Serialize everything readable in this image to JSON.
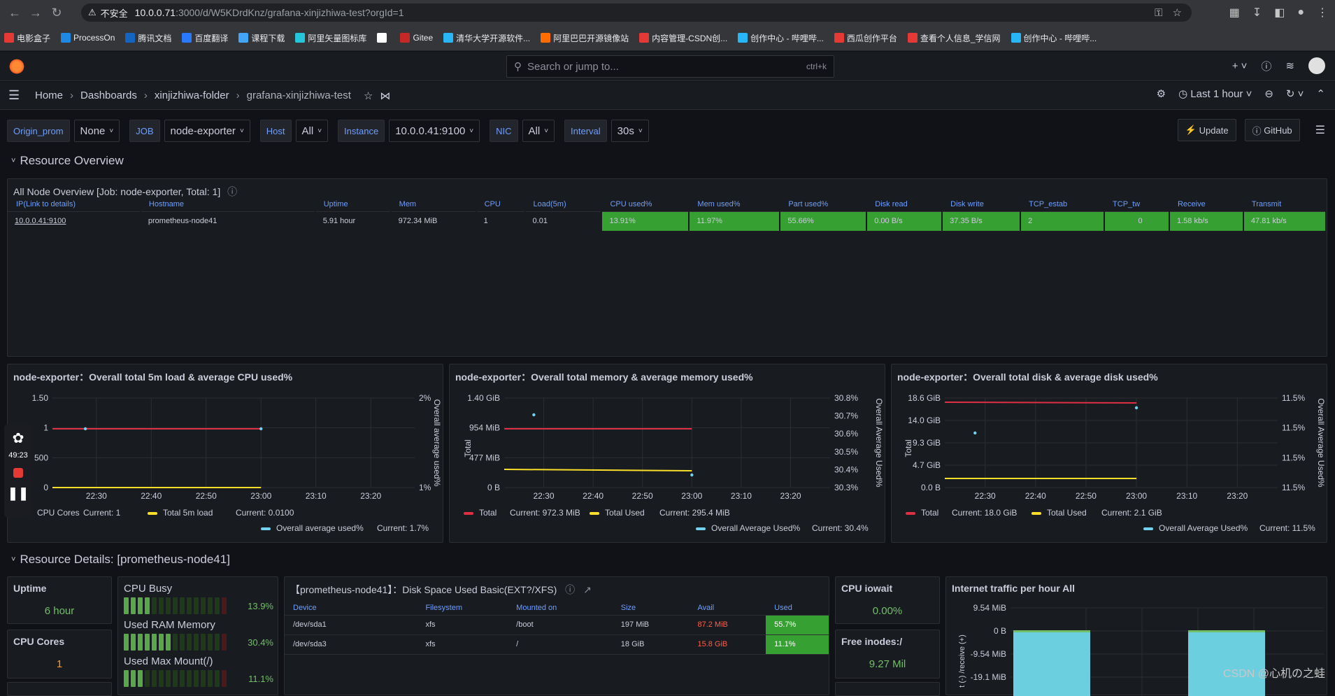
{
  "browser": {
    "security_warning": "不安全",
    "url_host": "10.0.0.71",
    "url_path": ":3000/d/W5KDrdKnz/grafana-xinjizhiwa-test?orgId=1",
    "bookmarks": [
      {
        "label": "电影盒子",
        "color": "#e53935"
      },
      {
        "label": "ProcessOn",
        "color": "#1e88e5"
      },
      {
        "label": "腾讯文档",
        "color": "#1565c0"
      },
      {
        "label": "百度翻译",
        "color": "#2979ff"
      },
      {
        "label": "课程下载",
        "color": "#42a5f5"
      },
      {
        "label": "阿里矢量图标库",
        "color": "#26c6da"
      },
      {
        "label": "",
        "color": "#ffffff"
      },
      {
        "label": "Gitee",
        "color": "#c62828"
      },
      {
        "label": "清华大学开源软件...",
        "color": "#29b6f6"
      },
      {
        "label": "阿里巴巴开源镜像站",
        "color": "#ff6d00"
      },
      {
        "label": "内容管理-CSDN创...",
        "color": "#e53935"
      },
      {
        "label": "创作中心 - 哔哩哔...",
        "color": "#29b6f6"
      },
      {
        "label": "西瓜创作平台",
        "color": "#e53935"
      },
      {
        "label": "查看个人信息_学信网",
        "color": "#e53935"
      },
      {
        "label": "创作中心 - 哔哩哔...",
        "color": "#29b6f6"
      }
    ]
  },
  "grafana": {
    "search_placeholder": "Search or jump to...",
    "search_shortcut": "ctrl+k",
    "breadcrumbs": [
      "Home",
      "Dashboards",
      "xinjizhiwa-folder",
      "grafana-xinjizhiwa-test"
    ],
    "time_range": "Last 1 hour",
    "variables": [
      {
        "label": "Origin_prom",
        "value": "None"
      },
      {
        "label": "JOB",
        "value": "node-exporter"
      },
      {
        "label": "Host",
        "value": "All"
      },
      {
        "label": "Instance",
        "value": "10.0.0.41:9100"
      },
      {
        "label": "NIC",
        "value": "All"
      },
      {
        "label": "Interval",
        "value": "30s"
      }
    ],
    "update_label": "Update",
    "github_label": "GitHub"
  },
  "row1_title": "Resource Overview",
  "overview": {
    "title": "All Node Overview [Job: node-exporter, Total: 1]",
    "headers": [
      "IP(Link to details)",
      "Hostname",
      "Uptime",
      "Mem",
      "CPU",
      "Load(5m)",
      "CPU used%",
      "Mem used%",
      "Part used%",
      "Disk read",
      "Disk write",
      "TCP_estab",
      "TCP_tw",
      "Receive",
      "Transmit"
    ],
    "row": [
      "10.0.0.41:9100",
      "prometheus-node41",
      "5.91 hour",
      "972.34 MiB",
      "1",
      "0.01",
      "13.91%",
      "11.97%",
      "55.66%",
      "0.00 B/s",
      "37.35 B/s",
      "2",
      "0",
      "1.58 kb/s",
      "47.81 kb/s"
    ]
  },
  "charts": {
    "cpu": {
      "title": "node-exporter：Overall total 5m load & average CPU used%",
      "y_ticks": [
        "1.50",
        "1",
        "500",
        "0"
      ],
      "y2_ticks": [
        "2%",
        "1%"
      ],
      "y2_label": "Overall average used%",
      "x_ticks": [
        "22:30",
        "22:40",
        "22:50",
        "23:00",
        "23:10",
        "23:20"
      ],
      "legend": [
        {
          "name": "CPU Cores",
          "current": "Current: 1",
          "color": "#e02f44"
        },
        {
          "name": "Total 5m load",
          "current": "Current: 0.0100",
          "color": "#fade2a"
        },
        {
          "name": "Overall average used%",
          "current": "Current: 1.7%",
          "color": "#73d2f0"
        }
      ]
    },
    "mem": {
      "title": "node-exporter：Overall total memory & average memory used%",
      "y_ticks": [
        "1.40 GiB",
        "954 MiB",
        "477 MiB",
        "0 B"
      ],
      "y2_ticks": [
        "30.8%",
        "30.7%",
        "30.6%",
        "30.5%",
        "30.4%",
        "30.3%"
      ],
      "y_label": "Total",
      "y2_label": "Overall Average Used%",
      "x_ticks": [
        "22:30",
        "22:40",
        "22:50",
        "23:00",
        "23:10",
        "23:20"
      ],
      "legend": [
        {
          "name": "Total",
          "current": "Current: 972.3 MiB",
          "color": "#e02f44"
        },
        {
          "name": "Total Used",
          "current": "Current: 295.4 MiB",
          "color": "#fade2a"
        },
        {
          "name": "Overall Average Used%",
          "current": "Current: 30.4%",
          "color": "#73d2f0"
        }
      ]
    },
    "disk": {
      "title": "node-exporter：Overall total disk & average disk used%",
      "y_ticks": [
        "18.6 GiB",
        "14.0 GiB",
        "9.3 GiB",
        "4.7 GiB",
        "0.0 B"
      ],
      "y2_ticks": [
        "11.5%",
        "11.5%",
        "11.5%",
        "11.5%"
      ],
      "y_label": "Total",
      "y2_label": "Overall Average Used%",
      "x_ticks": [
        "22:30",
        "22:40",
        "22:50",
        "23:00",
        "23:10",
        "23:20"
      ],
      "legend": [
        {
          "name": "Total",
          "current": "Current: 18.0 GiB",
          "color": "#e02f44"
        },
        {
          "name": "Total Used",
          "current": "Current: 2.1 GiB",
          "color": "#fade2a"
        },
        {
          "name": "Overall Average Used%",
          "current": "Current: 11.5%",
          "color": "#73d2f0"
        }
      ]
    }
  },
  "row2_title": "Resource Details: [prometheus-node41]",
  "details": {
    "uptime_label": "Uptime",
    "uptime_value": "6 hour",
    "cores_label": "CPU Cores",
    "cores_value": "1",
    "gauges": [
      {
        "label": "CPU Busy",
        "value": "13.9%",
        "fraction": 0.139
      },
      {
        "label": "Used RAM Memory",
        "value": "30.4%",
        "fraction": 0.304
      },
      {
        "label": "Used Max Mount(/)",
        "value": "11.1%",
        "fraction": 0.111
      }
    ],
    "disk_table_title": "【prometheus-node41】：Disk Space Used Basic(EXT?/XFS)",
    "disk_headers": [
      "Device",
      "Filesystem",
      "Mounted on",
      "Size",
      "Avail",
      "Used"
    ],
    "disk_rows": [
      [
        "/dev/sda1",
        "xfs",
        "/boot",
        "197 MiB",
        "87.2 MiB",
        "55.7%"
      ],
      [
        "/dev/sda3",
        "xfs",
        "/",
        "18 GiB",
        "15.8 GiB",
        "11.1%"
      ]
    ],
    "iowait_label": "CPU iowait",
    "iowait_value": "0.00%",
    "inodes_label": "Free inodes:/",
    "inodes_value": "9.27 Mil",
    "traffic_title": "Internet traffic per hour All",
    "traffic_ticks": [
      "9.54 MiB",
      "0 B",
      "-9.54 MiB",
      "-19.1 MiB"
    ],
    "traffic_ylabel": "t (-) /receive (+)"
  },
  "recorder_time": "49:23",
  "watermark": "CSDN @心机の之蛙"
}
